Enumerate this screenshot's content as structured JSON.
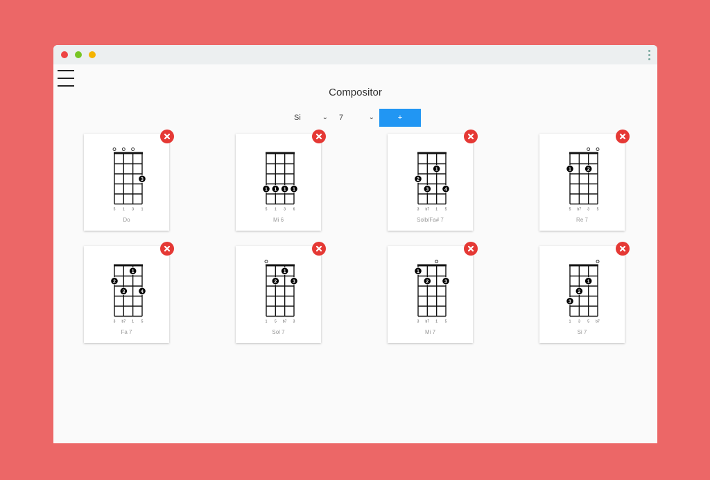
{
  "window": {
    "traffic_lights": [
      {
        "name": "close",
        "color": "#ee4444"
      },
      {
        "name": "minimize",
        "color": "#78c524"
      },
      {
        "name": "maximize",
        "color": "#f5b400"
      }
    ]
  },
  "menu_icon": "hamburger-menu-icon",
  "title": "Compositor",
  "controls": {
    "root_select": "Si",
    "type_select": "7",
    "add_label": "+"
  },
  "colors": {
    "background": "#ec6767",
    "accent": "#2196f3",
    "remove": "#e53935",
    "dot": "#000000"
  },
  "chords": [
    {
      "name": "Do",
      "open": [
        0,
        1,
        2
      ],
      "dots": [
        {
          "string": 3,
          "fret": 3,
          "finger": "3"
        }
      ],
      "degrees": [
        "5",
        "1",
        "3",
        "1"
      ]
    },
    {
      "name": "Mi 6",
      "open": [],
      "dots": [
        {
          "string": 0,
          "fret": 4,
          "finger": "1"
        },
        {
          "string": 1,
          "fret": 4,
          "finger": "1"
        },
        {
          "string": 2,
          "fret": 4,
          "finger": "1"
        },
        {
          "string": 3,
          "fret": 4,
          "finger": "1"
        }
      ],
      "degrees": [
        "5",
        "1",
        "3",
        "6"
      ]
    },
    {
      "name": "Solb/Fa# 7",
      "open": [],
      "dots": [
        {
          "string": 2,
          "fret": 2,
          "finger": "1"
        },
        {
          "string": 0,
          "fret": 3,
          "finger": "2"
        },
        {
          "string": 1,
          "fret": 4,
          "finger": "3"
        },
        {
          "string": 3,
          "fret": 4,
          "finger": "4"
        }
      ],
      "degrees": [
        "3",
        "b7",
        "1",
        "5"
      ]
    },
    {
      "name": "Re 7",
      "open": [
        2,
        3
      ],
      "dots": [
        {
          "string": 0,
          "fret": 2,
          "finger": "1"
        },
        {
          "string": 2,
          "fret": 2,
          "finger": "2"
        }
      ],
      "degrees": [
        "5",
        "b7",
        "3",
        "5"
      ]
    },
    {
      "name": "Fa 7",
      "open": [],
      "dots": [
        {
          "string": 2,
          "fret": 1,
          "finger": "1"
        },
        {
          "string": 0,
          "fret": 2,
          "finger": "2"
        },
        {
          "string": 1,
          "fret": 3,
          "finger": "3"
        },
        {
          "string": 3,
          "fret": 3,
          "finger": "4"
        }
      ],
      "degrees": [
        "3",
        "b7",
        "1",
        "5"
      ]
    },
    {
      "name": "Sol 7",
      "open": [
        0
      ],
      "dots": [
        {
          "string": 2,
          "fret": 1,
          "finger": "1"
        },
        {
          "string": 1,
          "fret": 2,
          "finger": "2"
        },
        {
          "string": 3,
          "fret": 2,
          "finger": "3"
        }
      ],
      "degrees": [
        "1",
        "5",
        "b7",
        "3"
      ]
    },
    {
      "name": "Mi 7",
      "open": [
        2
      ],
      "dots": [
        {
          "string": 0,
          "fret": 1,
          "finger": "1"
        },
        {
          "string": 1,
          "fret": 2,
          "finger": "2"
        },
        {
          "string": 3,
          "fret": 2,
          "finger": "3"
        }
      ],
      "degrees": [
        "3",
        "b7",
        "1",
        "5"
      ]
    },
    {
      "name": "Si 7",
      "open": [
        3
      ],
      "dots": [
        {
          "string": 2,
          "fret": 2,
          "finger": "1"
        },
        {
          "string": 1,
          "fret": 3,
          "finger": "2"
        },
        {
          "string": 0,
          "fret": 4,
          "finger": "3"
        }
      ],
      "degrees": [
        "1",
        "3",
        "5",
        "b7"
      ]
    }
  ]
}
